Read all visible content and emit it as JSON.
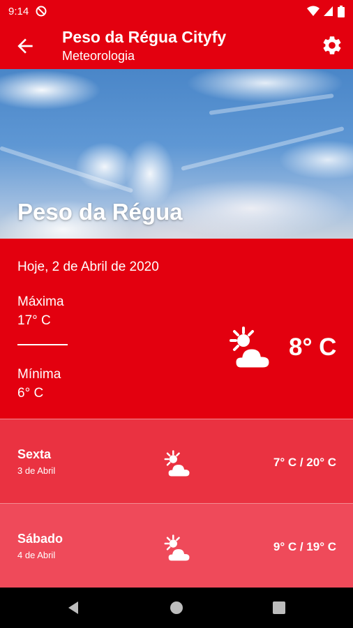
{
  "statusbar": {
    "time": "9:14"
  },
  "appbar": {
    "title": "Peso da Régua Cityfy",
    "subtitle": "Meteorologia"
  },
  "hero": {
    "city": "Peso da Régua"
  },
  "today": {
    "date": "Hoje, 2 de Abril de 2020",
    "max_label": "Máxima",
    "max_value": "17° C",
    "min_label": "Mínima",
    "min_value": "6° C",
    "current_temp": "8° C",
    "icon": "partly-cloudy-icon"
  },
  "forecast": [
    {
      "day": "Sexta",
      "date": "3 de Abril",
      "range": "7° C / 20° C",
      "icon": "partly-cloudy-icon",
      "bg": "#ea3241"
    },
    {
      "day": "Sábado",
      "date": "4 de Abril",
      "range": "9° C / 19° C",
      "icon": "partly-cloudy-icon",
      "bg": "#ef4a5a"
    }
  ],
  "colors": {
    "primary": "#e3000f",
    "row1": "#ea3241",
    "row2": "#ef4a5a"
  }
}
